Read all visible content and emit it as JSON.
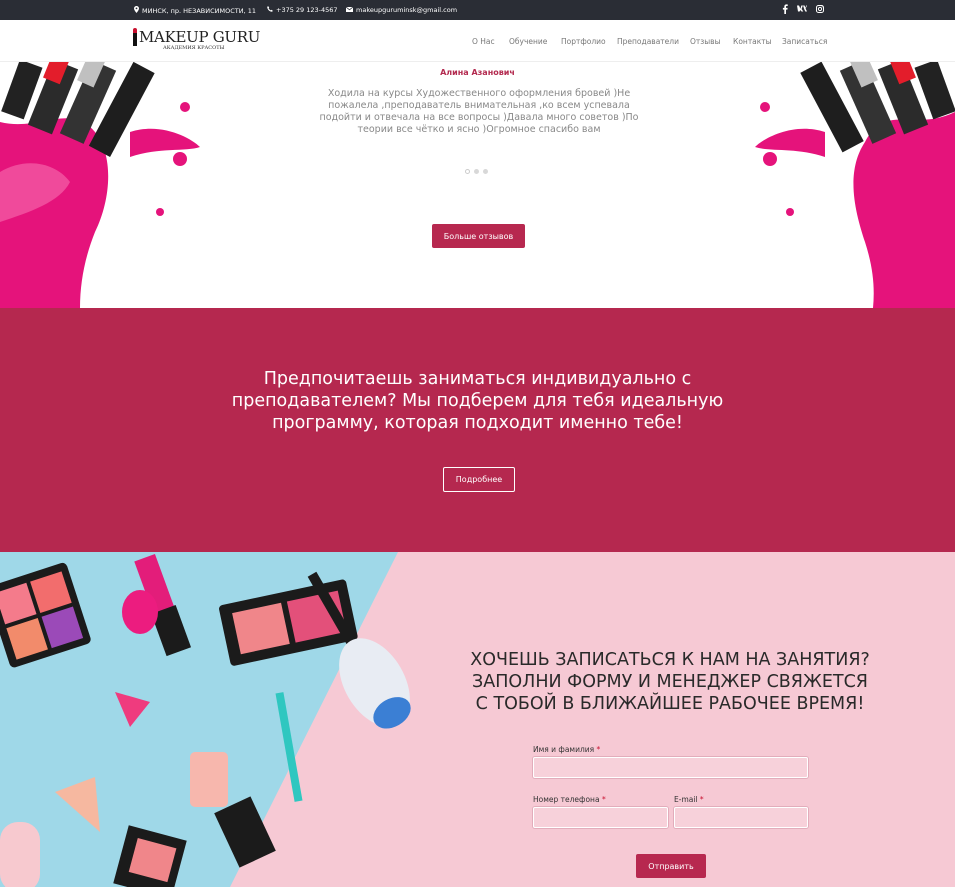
{
  "topbar": {
    "address": "МИНСК, пр. НЕЗАВИСИМОСТИ, 11",
    "phone": "+375 29 123-4567",
    "email": "makeupguruminsk@gmail.com",
    "social": [
      "facebook-icon",
      "vk-icon",
      "instagram-icon"
    ]
  },
  "logo": {
    "name": "MAKEUP GURU",
    "subtitle": "АКАДЕМИЯ КРАСОТЫ"
  },
  "nav": {
    "items": [
      "О Нас",
      "Обучение",
      "Портфолио",
      "Преподаватели",
      "Отзывы",
      "Контакты",
      "Записаться"
    ]
  },
  "testimonial": {
    "author": "Алина Азанович",
    "text": "Ходила на курсы Художественного оформления бровей )Не пожалела ,преподаватель внимательная ,ко всем успевала подойти и отвечала на все вопросы )Давала много советов )По теории все чётко и ясно )Огромное спасибо вам",
    "slides": 3,
    "active_slide": 1,
    "more_button": "Больше отзывов"
  },
  "promo": {
    "heading": "Предпочитаешь заниматься индивидуально с преподавателем? Мы подберем для тебя идеальную программу, которая подходит именно тебе!",
    "button": "Подробнее"
  },
  "signup": {
    "heading": "ХОЧЕШЬ ЗАПИСАТЬСЯ К НАМ НА ЗАНЯТИЯ? ЗАПОЛНИ ФОРМУ И МЕНЕДЖЕР СВЯЖЕТСЯ С ТОБОЙ В БЛИЖАЙШЕЕ РАБОЧЕЕ ВРЕМЯ!",
    "name_label": "Имя и фамилия",
    "phone_label": "Номер телефона",
    "email_label": "E-mail",
    "required_mark": "*",
    "submit": "Отправить"
  },
  "colors": {
    "accent": "#b5284f",
    "topbar": "#2a2d35",
    "signup_bg": "#f6c9d4",
    "blue_bg": "#9fd8e8"
  }
}
